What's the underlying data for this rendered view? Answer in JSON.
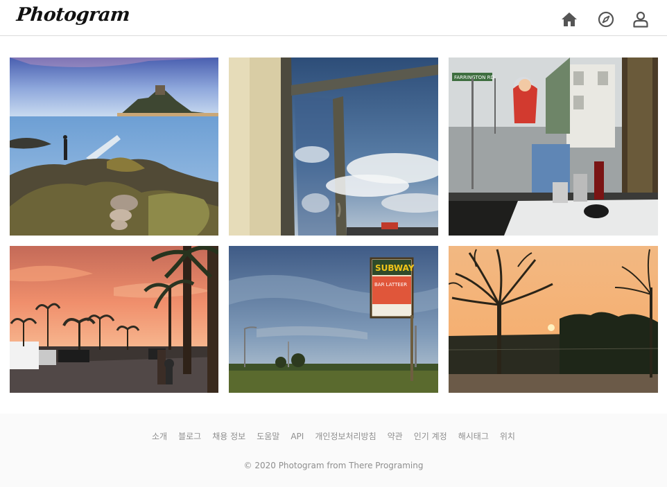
{
  "header": {
    "logo_text": "Photogram",
    "icons": [
      "home-icon",
      "compass-icon",
      "user-icon"
    ]
  },
  "gallery": {
    "photos": [
      {
        "subject": "island castle at sea"
      },
      {
        "subject": "window with sky reflection"
      },
      {
        "subject": "diner window with street sign"
      },
      {
        "subject": "palm trees at sunset street"
      },
      {
        "subject": "subway sign at dusk"
      },
      {
        "subject": "bare trees at sunset"
      }
    ],
    "signs": {
      "farrington": "FARRINGTON RD",
      "subway": "SUBWAY",
      "subway_sub": "BAR LATTEER"
    }
  },
  "footer": {
    "links": [
      "소개",
      "블로그",
      "채용 정보",
      "도움말",
      "API",
      "개인정보처리방침",
      "약관",
      "인기 계정",
      "해시태그",
      "위치"
    ],
    "copyright": "© 2020 Photogram from There Programing"
  },
  "colors": {
    "border": "#dbdbdb",
    "footer_bg": "#fafafa",
    "footer_text": "#8e8e8e",
    "icon": "#555555"
  }
}
